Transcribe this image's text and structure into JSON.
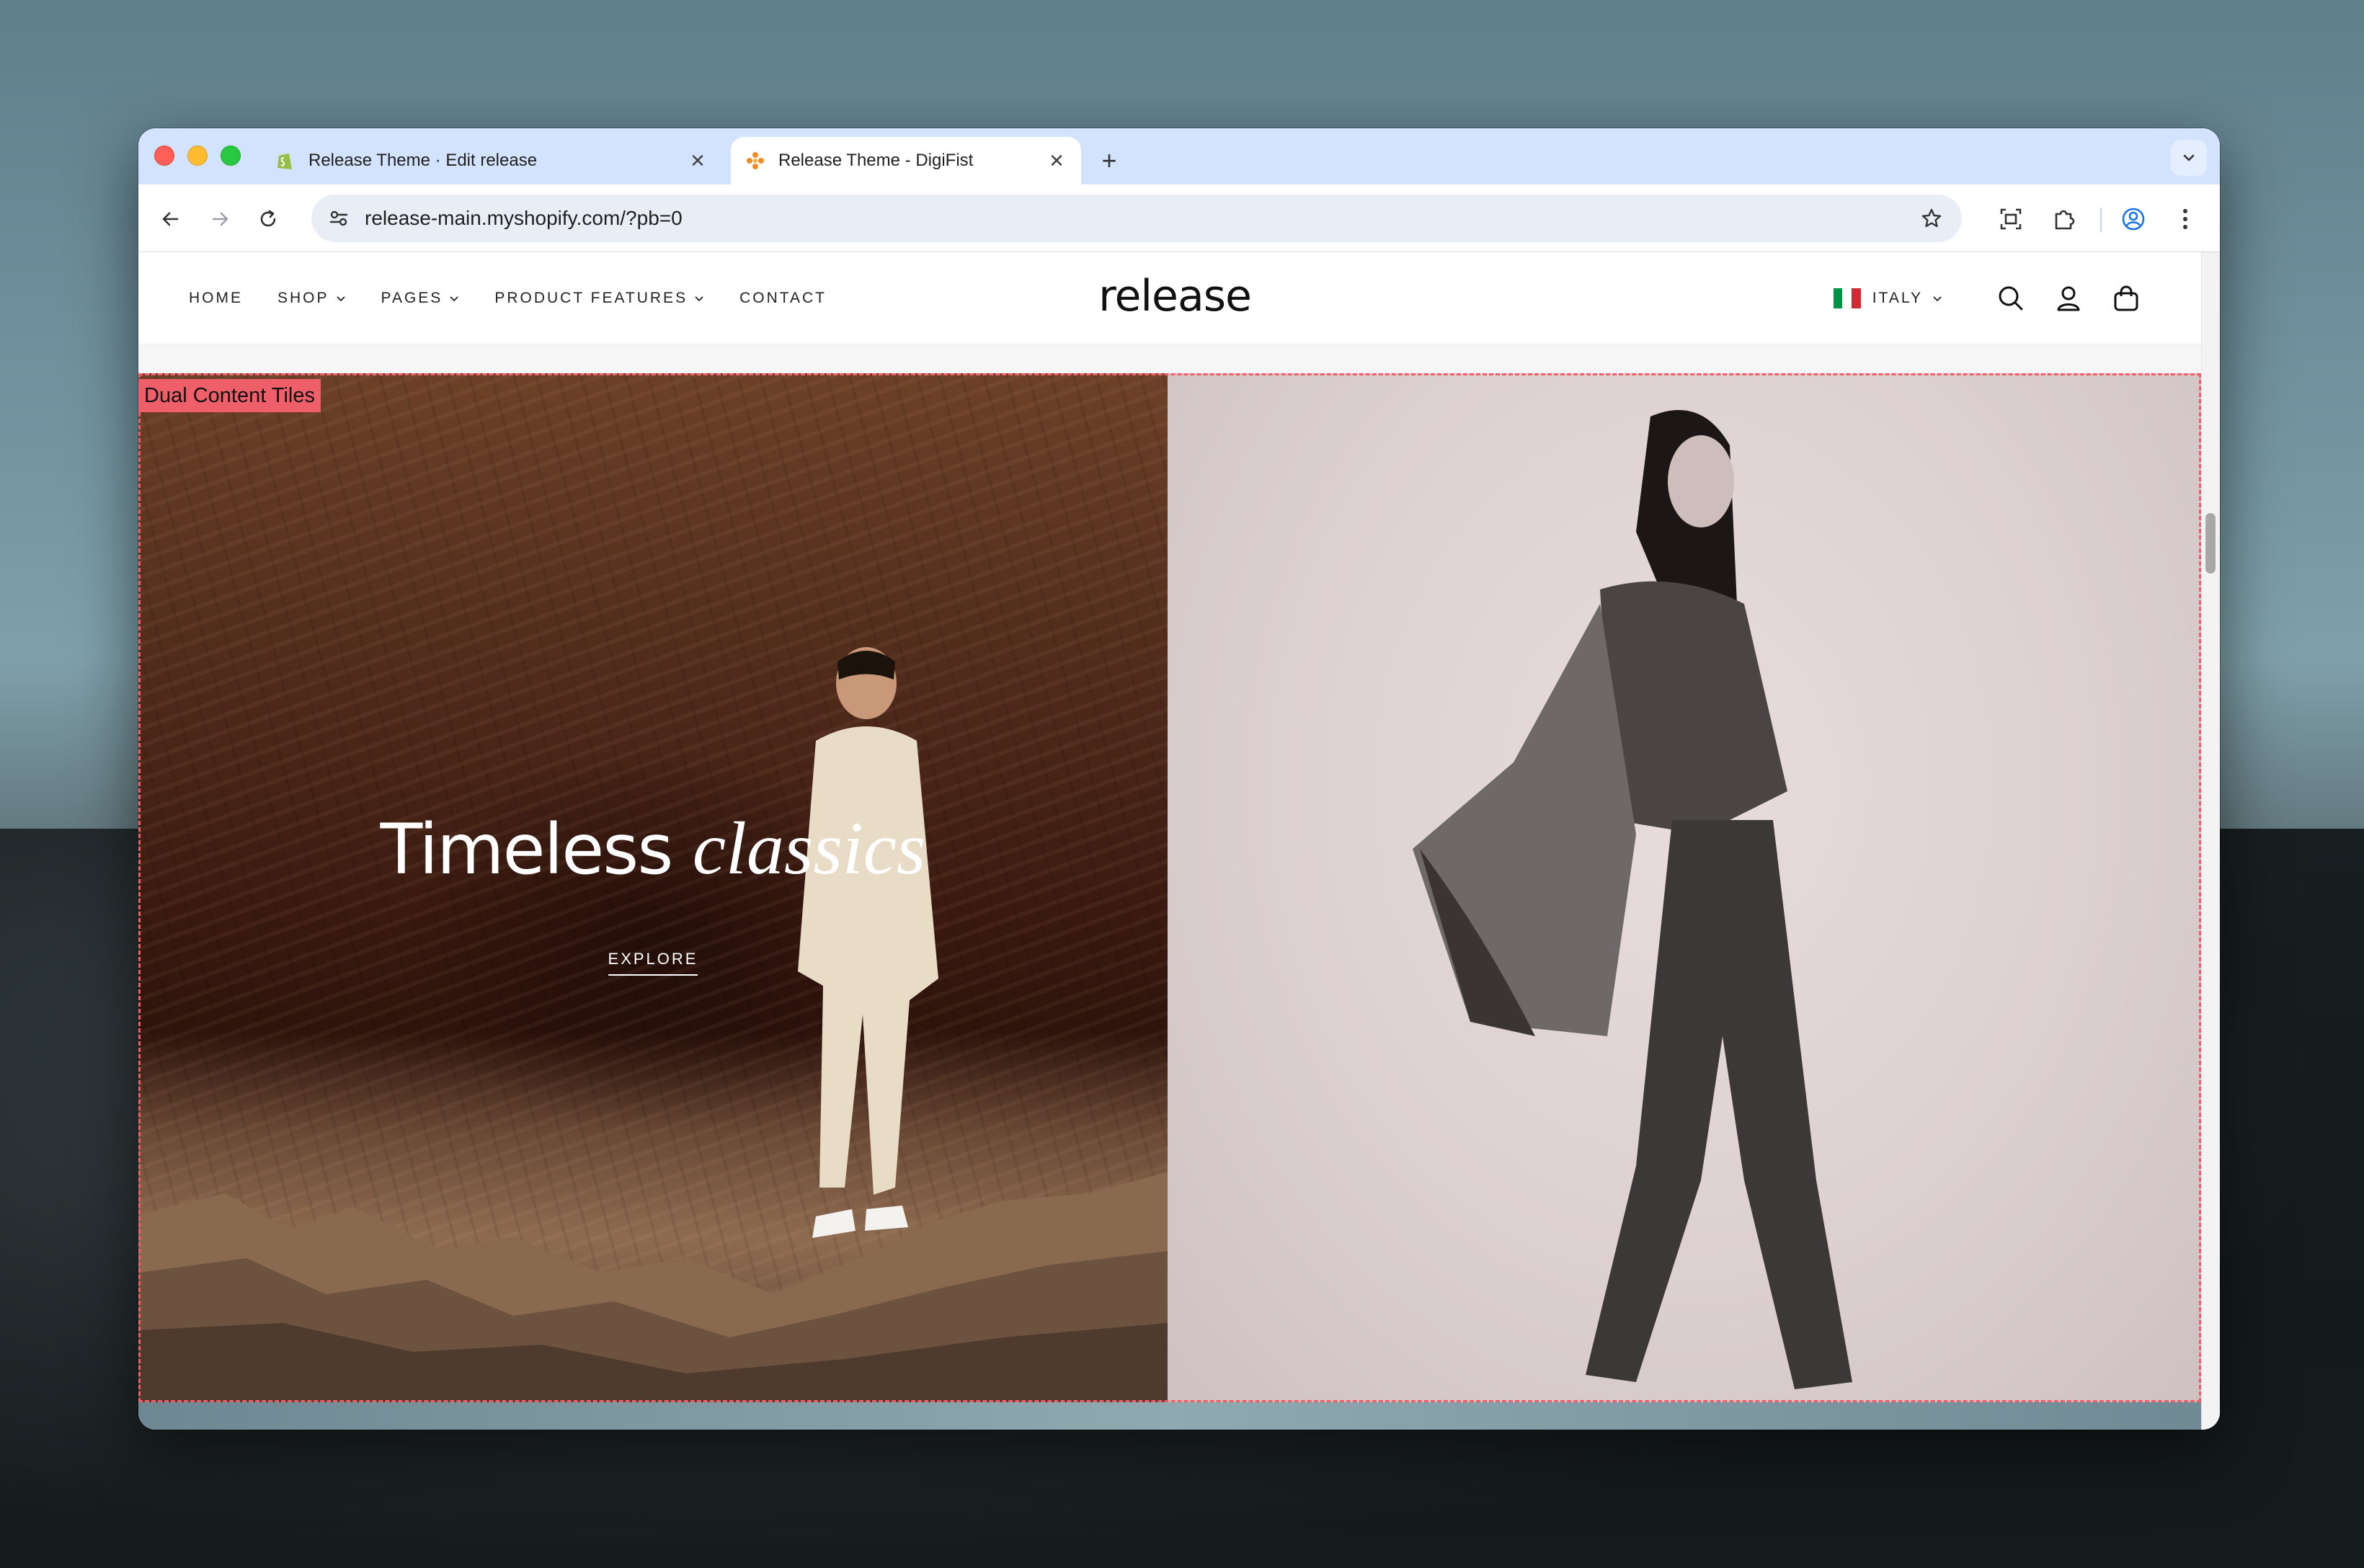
{
  "browser": {
    "tabs": [
      {
        "title": "Release Theme · Edit release",
        "favicon": "shopify-icon",
        "active": false
      },
      {
        "title": "Release Theme - DigiFist",
        "favicon": "digifist-icon",
        "active": true
      }
    ],
    "new_tab_label": "+",
    "close_glyph": "✕",
    "address_url": "release-main.myshopify.com/?pb=0",
    "icons": [
      "back-icon",
      "forward-icon",
      "reload-icon",
      "site-settings-icon",
      "star-icon",
      "screen-capture-icon",
      "extensions-icon",
      "profile-icon",
      "menu-icon",
      "tab-search-icon"
    ]
  },
  "site": {
    "logo": "release",
    "nav": [
      {
        "label": "HOME",
        "dropdown": false
      },
      {
        "label": "SHOP",
        "dropdown": true
      },
      {
        "label": "PAGES",
        "dropdown": true
      },
      {
        "label": "PRODUCT FEATURES",
        "dropdown": true
      },
      {
        "label": "CONTACT",
        "dropdown": false
      }
    ],
    "country": "ITALY",
    "flag_colors": [
      "#009246",
      "#ffffff",
      "#ce2b37"
    ],
    "header_icons": [
      "search-icon",
      "account-icon",
      "cart-icon"
    ]
  },
  "section": {
    "badge": "Dual  Content Tiles",
    "badge_color": "#ee5f69",
    "left_tile": {
      "headline_regular": "Timeless ",
      "headline_italic": "classics",
      "cta": "EXPLORE"
    }
  },
  "scroll_top_icon": "chevron-up-icon"
}
